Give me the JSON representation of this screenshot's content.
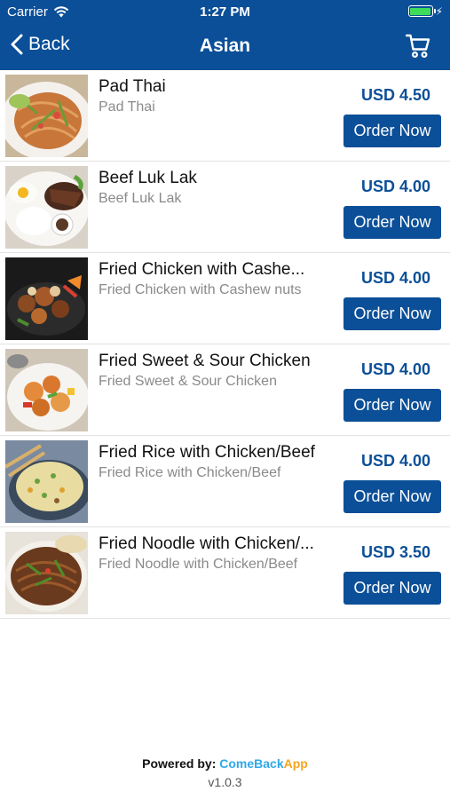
{
  "status_bar": {
    "carrier": "Carrier",
    "time": "1:27 PM",
    "battery_color": "#3ddc5a"
  },
  "nav": {
    "back_label": "Back",
    "title": "Asian",
    "cart_icon": "cart-icon"
  },
  "colors": {
    "primary": "#0b4f98",
    "brand_come_back": "#2fa8e8",
    "brand_app": "#f5a623"
  },
  "items": [
    {
      "name": "Pad Thai",
      "description": "Pad Thai",
      "price": "USD 4.50",
      "button": "Order Now"
    },
    {
      "name": "Beef Luk Lak",
      "description": "Beef Luk Lak",
      "price": "USD 4.00",
      "button": "Order Now"
    },
    {
      "name": "Fried Chicken with Cashe...",
      "description": "Fried Chicken with Cashew nuts",
      "price": "USD 4.00",
      "button": "Order Now"
    },
    {
      "name": "Fried Sweet & Sour Chicken",
      "description": "Fried Sweet & Sour Chicken",
      "price": "USD 4.00",
      "button": "Order Now"
    },
    {
      "name": "Fried Rice with Chicken/Beef",
      "description": "Fried Rice with Chicken/Beef",
      "price": "USD 4.00",
      "button": "Order Now"
    },
    {
      "name": "Fried Noodle with Chicken/...",
      "description": "Fried Noodle with Chicken/Beef",
      "price": "USD 3.50",
      "button": "Order Now"
    }
  ],
  "footer": {
    "powered_by": "Powered by:",
    "brand_part1": "ComeBack",
    "brand_part2": "App",
    "version": "v1.0.3"
  }
}
